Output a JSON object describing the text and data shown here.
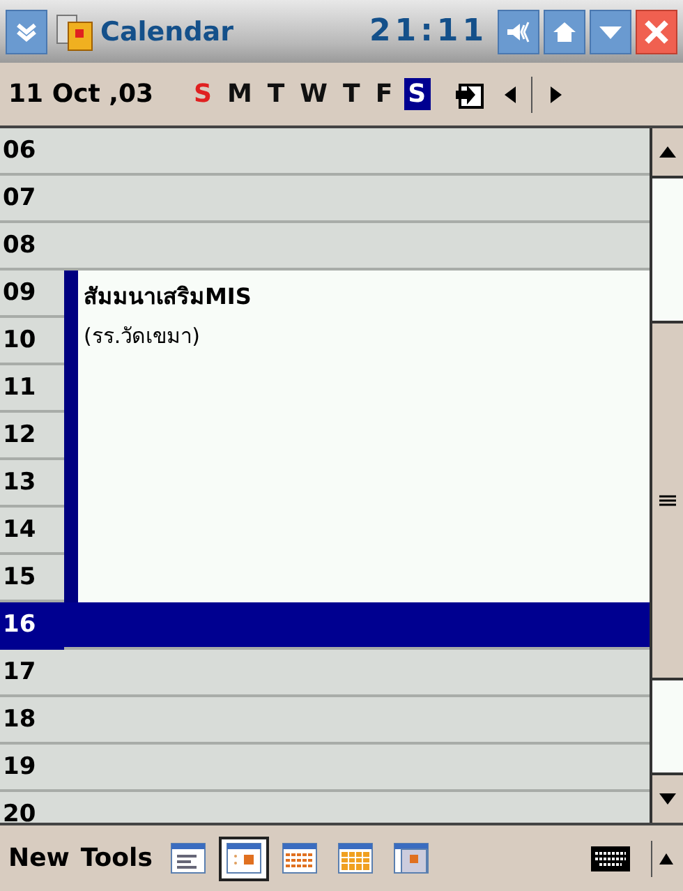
{
  "window": {
    "title": "Calendar",
    "time": "21:11"
  },
  "date_bar": {
    "date": "11 Oct ,03",
    "days": [
      {
        "label": "S",
        "selected": false,
        "kind": "sunday"
      },
      {
        "label": "M",
        "selected": false,
        "kind": "weekday"
      },
      {
        "label": "T",
        "selected": false,
        "kind": "weekday"
      },
      {
        "label": "W",
        "selected": false,
        "kind": "weekday"
      },
      {
        "label": "T",
        "selected": false,
        "kind": "weekday"
      },
      {
        "label": "F",
        "selected": false,
        "kind": "weekday"
      },
      {
        "label": "S",
        "selected": true,
        "kind": "weekday"
      }
    ]
  },
  "hours": [
    {
      "label": "06",
      "in_event": false,
      "selected": false
    },
    {
      "label": "07",
      "in_event": false,
      "selected": false
    },
    {
      "label": "08",
      "in_event": false,
      "selected": false
    },
    {
      "label": "09",
      "in_event": true,
      "selected": false
    },
    {
      "label": "10",
      "in_event": true,
      "selected": false
    },
    {
      "label": "11",
      "in_event": true,
      "selected": false
    },
    {
      "label": "12",
      "in_event": true,
      "selected": false
    },
    {
      "label": "13",
      "in_event": true,
      "selected": false
    },
    {
      "label": "14",
      "in_event": true,
      "selected": false
    },
    {
      "label": "15",
      "in_event": true,
      "selected": false
    },
    {
      "label": "16",
      "in_event": false,
      "selected": true
    },
    {
      "label": "17",
      "in_event": false,
      "selected": false
    },
    {
      "label": "18",
      "in_event": false,
      "selected": false
    },
    {
      "label": "19",
      "in_event": false,
      "selected": false
    },
    {
      "label": "20",
      "in_event": false,
      "selected": false
    }
  ],
  "event": {
    "title": "สัมมนาเสริมMIS",
    "location": "(รร.วัดเขมา)"
  },
  "menu": [
    "New",
    "Tools"
  ],
  "views": [
    {
      "kind": "agenda",
      "selected": false
    },
    {
      "kind": "day",
      "selected": true
    },
    {
      "kind": "week",
      "selected": false
    },
    {
      "kind": "month",
      "selected": false
    },
    {
      "kind": "year",
      "selected": false
    }
  ]
}
